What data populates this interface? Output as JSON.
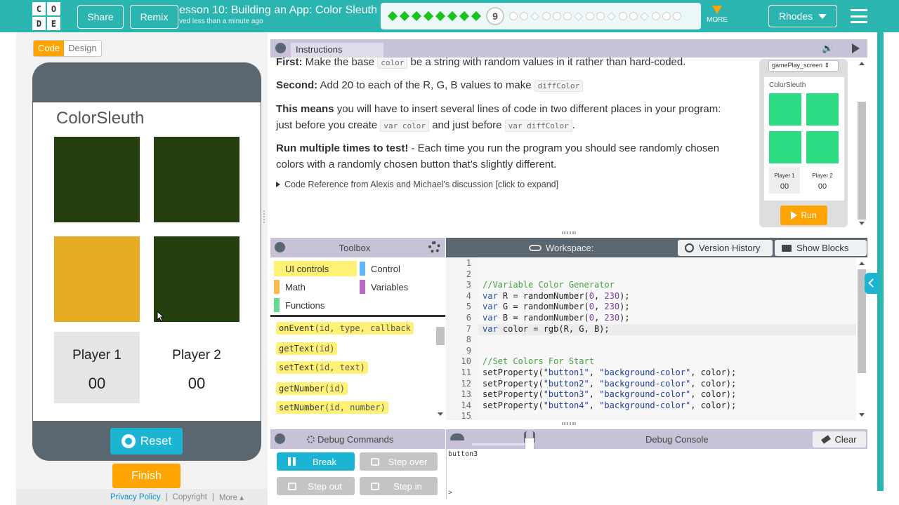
{
  "header": {
    "logo_letters": [
      "C",
      "O",
      "D",
      "E"
    ],
    "share_label": "Share",
    "remix_label": "Remix",
    "lesson_title": "esson 10: Building an App: Color Sleuth",
    "saved_text": "ved less than a minute ago",
    "progress_current": "9",
    "progress_completed_count": 8,
    "more_label": "MORE",
    "user_label": "Rhodes",
    "accent_color": "#2bb5b0"
  },
  "mode_toggle": {
    "code_label": "Code",
    "design_label": "Design",
    "selected": "Code"
  },
  "app": {
    "title": "ColorSleuth",
    "button_colors": [
      "#263f0f",
      "#263f0f",
      "#e7ac23",
      "#263f0f"
    ],
    "player1_label": "Player 1",
    "player1_score": "00",
    "player2_label": "Player 2",
    "player2_score": "00",
    "reset_label": "Reset",
    "finish_label": "Finish"
  },
  "footer": {
    "privacy": "Privacy Policy",
    "sep": "|",
    "copyright": "Copyright",
    "more": "More ▴"
  },
  "instructions": {
    "tab_label": "Instructions",
    "p1_bold": "First:",
    "p1_a": " Make the base ",
    "p1_code": "color",
    "p1_b": " be a string with random values in it rather than hard-coded.",
    "p2_bold": "Second:",
    "p2_a": " Add 20 to each of the R, G, B values to make ",
    "p2_code": "diffColor",
    "p3_bold": "This means",
    "p3_a": " you will have to insert several lines of code in two different places in your program: just before you create ",
    "p3_code1": "var color",
    "p3_b": " and just before ",
    "p3_code2": "var diffColor",
    "p3_c": ".",
    "p4_bold": "Run multiple times to test!",
    "p4_a": " - Each time you run the program you should see randomly chosen colors with a randomly chosen button that's slightly different.",
    "details": "Code Reference from Alexis and Michael's discussion [click to expand]"
  },
  "preview": {
    "screen_select": "gamePlay_screen",
    "title": "ColorSleuth",
    "player1_label": "Player 1",
    "player1_score": "00",
    "player2_label": "Player 2",
    "player2_score": "00",
    "run_label": "Run",
    "square_color": "#2ddc82"
  },
  "toolbox": {
    "title": "Toolbox",
    "categories": [
      {
        "label": "UI controls",
        "color": "#fff176"
      },
      {
        "label": "Control",
        "color": "#64b5f6"
      },
      {
        "label": "Math",
        "color": "#ffb74d"
      },
      {
        "label": "Variables",
        "color": "#ba68c8"
      },
      {
        "label": "Functions",
        "color": "#68d995"
      }
    ],
    "blocks": [
      {
        "name": "onEvent",
        "params": "(id, type, callback"
      },
      {
        "name": "getText",
        "params": "(id)"
      },
      {
        "name": "setText",
        "params": "(id, text)"
      },
      {
        "name": "getNumber",
        "params": "(id)"
      },
      {
        "name": "setNumber",
        "params": "(id, number)"
      }
    ]
  },
  "workspace": {
    "title": "Workspace:",
    "version_history_label": "Version History",
    "show_blocks_label": "Show Blocks",
    "line_numbers": [
      "1",
      "2",
      "3",
      "4",
      "5",
      "6",
      "7",
      "8",
      "9",
      "10",
      "11",
      "12",
      "13",
      "14",
      "15"
    ],
    "code": {
      "l3": "//Variable Color Generator",
      "l4_kw": "var",
      "l4_a": " R = randomNumber(",
      "l4_n1": "0",
      "l4_b": ", ",
      "l4_n2": "230",
      "l4_c": ");",
      "l5_kw": "var",
      "l5_a": " G = randomNumber(",
      "l5_n1": "0",
      "l5_b": ", ",
      "l5_n2": "230",
      "l5_c": ");",
      "l6_kw": "var",
      "l6_a": " B = randomNumber(",
      "l6_n1": "0",
      "l6_b": ", ",
      "l6_n2": "230",
      "l6_c": ");",
      "l7_kw": "var",
      "l7_a": " color = rgb(R, G, B);",
      "l10": "//Set Colors For Start",
      "l11_a": "setProperty(",
      "l11_s1": "\"button1\"",
      "l11_b": ", ",
      "l11_s2": "\"background-color\"",
      "l11_c": ", color);",
      "l12_a": "setProperty(",
      "l12_s1": "\"button2\"",
      "l12_b": ", ",
      "l12_s2": "\"background-color\"",
      "l12_c": ", color);",
      "l13_a": "setProperty(",
      "l13_s1": "\"button3\"",
      "l13_b": ", ",
      "l13_s2": "\"background-color\"",
      "l13_c": ", color);",
      "l14_a": "setProperty(",
      "l14_s1": "\"button4\"",
      "l14_b": ", ",
      "l14_s2": "\"background-color\"",
      "l14_c": ", color);"
    }
  },
  "debug": {
    "commands_title": "Debug Commands",
    "console_title": "Debug Console",
    "clear_label": "Clear",
    "break_label": "Break",
    "step_over_label": "Step over",
    "step_out_label": "Step out",
    "step_in_label": "Step in",
    "console_output": "button3",
    "prompt": ">"
  }
}
